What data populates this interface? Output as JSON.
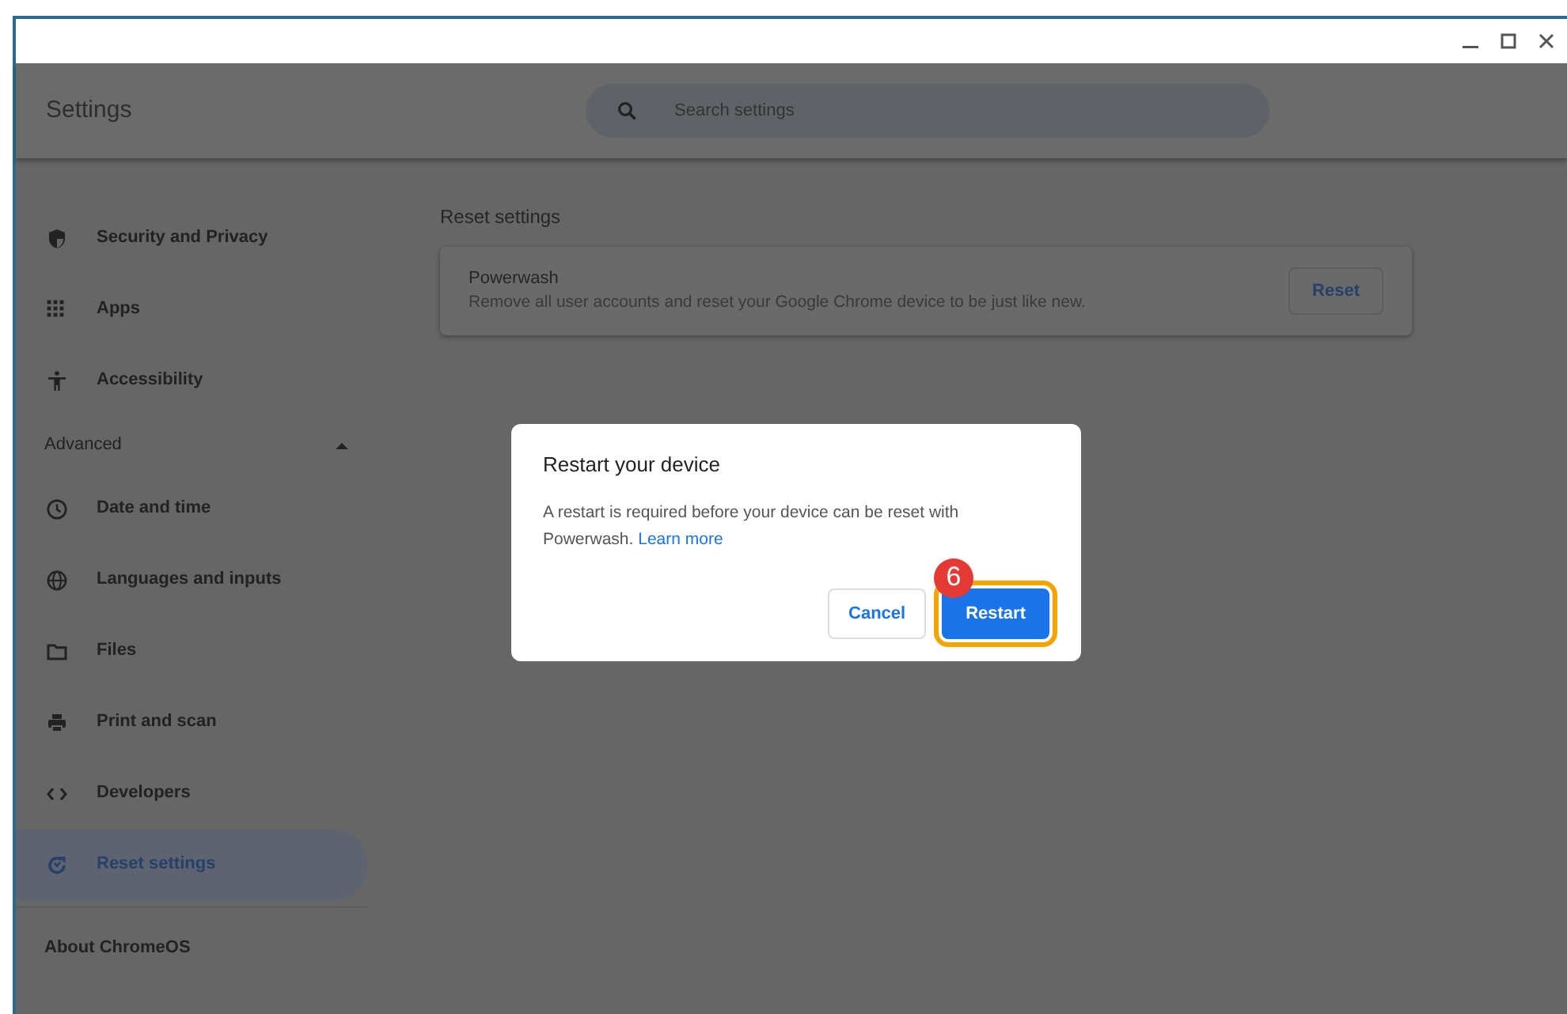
{
  "header": {
    "title": "Settings",
    "search": {
      "placeholder": "Search settings"
    }
  },
  "sidebar": {
    "items": [
      {
        "label": "Security and Privacy",
        "selected": false
      },
      {
        "label": "Apps",
        "selected": false
      },
      {
        "label": "Accessibility",
        "selected": false
      }
    ],
    "advanced": {
      "label": "Advanced",
      "expanded": true,
      "items": [
        {
          "label": "Date and time",
          "selected": false
        },
        {
          "label": "Languages and inputs",
          "selected": false
        },
        {
          "label": "Files",
          "selected": false
        },
        {
          "label": "Print and scan",
          "selected": false
        },
        {
          "label": "Developers",
          "selected": false
        },
        {
          "label": "Reset settings",
          "selected": true
        }
      ]
    },
    "about": {
      "label": "About ChromeOS"
    }
  },
  "main": {
    "section_title": "Reset settings",
    "powerwash": {
      "title": "Powerwash",
      "description": "Remove all user accounts and reset your Google Chrome device to be just like new.",
      "button": "Reset"
    }
  },
  "dialog": {
    "title": "Restart your device",
    "message": "A restart is required before your device can be reset with Powerwash.",
    "link": "Learn more",
    "step_badge": "6",
    "buttons": [
      {
        "label": "Cancel",
        "kind": "secondary",
        "highlighted": false
      },
      {
        "label": "Restart",
        "kind": "primary",
        "highlighted": true
      }
    ]
  }
}
